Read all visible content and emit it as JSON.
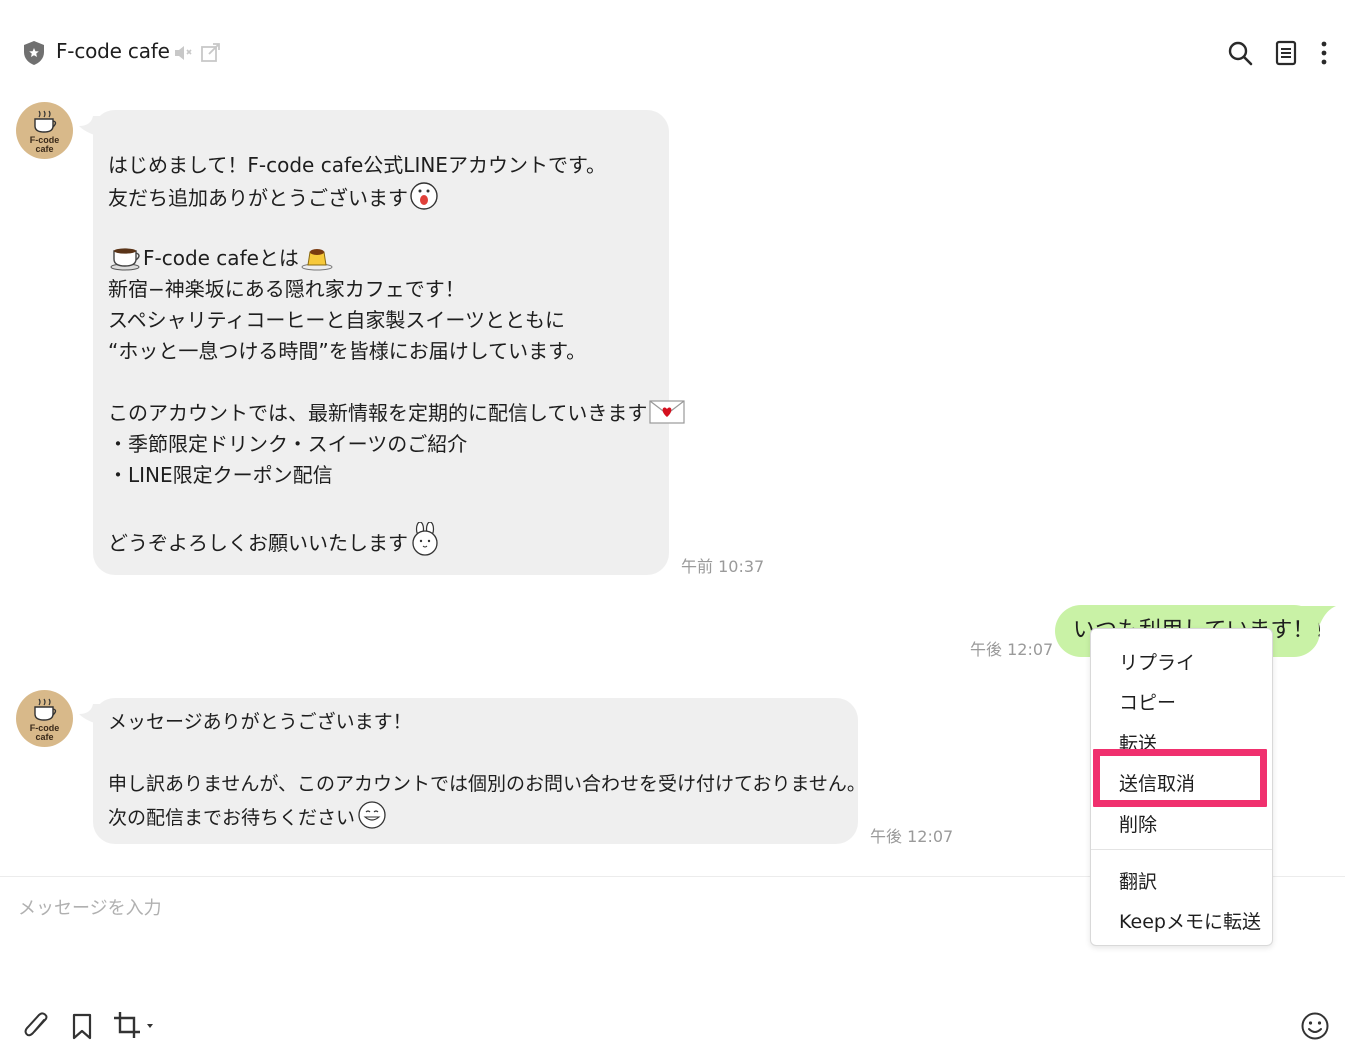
{
  "header": {
    "title": "F-code cafe",
    "icons": [
      "shield-icon",
      "speaker-muted-icon",
      "external-link-icon",
      "search-icon",
      "notes-icon",
      "more-vertical-icon"
    ]
  },
  "avatar": {
    "line1": "F-code",
    "line2": "cafe"
  },
  "messages": [
    {
      "sender": "F-code cafe",
      "lines": [
        "はじめまして！F-code cafe公式LINEアカウントです。",
        "友だち追加ありがとうございます",
        "",
        "F-code cafeとは",
        "新宿−神楽坂にある隠れ家カフェです！",
        "スペシャリティコーヒーと自家製スイーツとともに",
        "“ホッと一息つける時間”を皆様にお届けしています。",
        "",
        "このアカウントでは、最新情報を定期的に配信していきます",
        "・季節限定ドリンク・スイーツのご紹介",
        "・LINE限定クーポン配信",
        "",
        "どうぞよろしくお願いいたします"
      ],
      "time": "午前 10:37"
    },
    {
      "sender": "me",
      "text": "いつも利用しています！！",
      "time": "午後 12:07"
    },
    {
      "sender": "F-code cafe",
      "lines": [
        "メッセージありがとうございます！",
        "",
        "申し訳ありませんが、このアカウントでは個別のお問い合わせを受け付けておりません。",
        "次の配信までお待ちください"
      ],
      "time": "午後 12:07"
    }
  ],
  "input": {
    "placeholder": "メッセージを入力"
  },
  "toolbar": {
    "icons": [
      "paperclip-icon",
      "bookmark-icon",
      "crop-icon",
      "emoji-icon"
    ]
  },
  "context_menu": {
    "items": [
      "リプライ",
      "コピー",
      "転送",
      "送信取消",
      "削除",
      "翻訳",
      "Keepメモに転送"
    ],
    "highlighted": "送信取消",
    "highlight_color": "#f0306e"
  },
  "colors": {
    "my_bubble": "#c9f2a6",
    "their_bubble": "#efefef",
    "avatar": "#d8b98a"
  }
}
